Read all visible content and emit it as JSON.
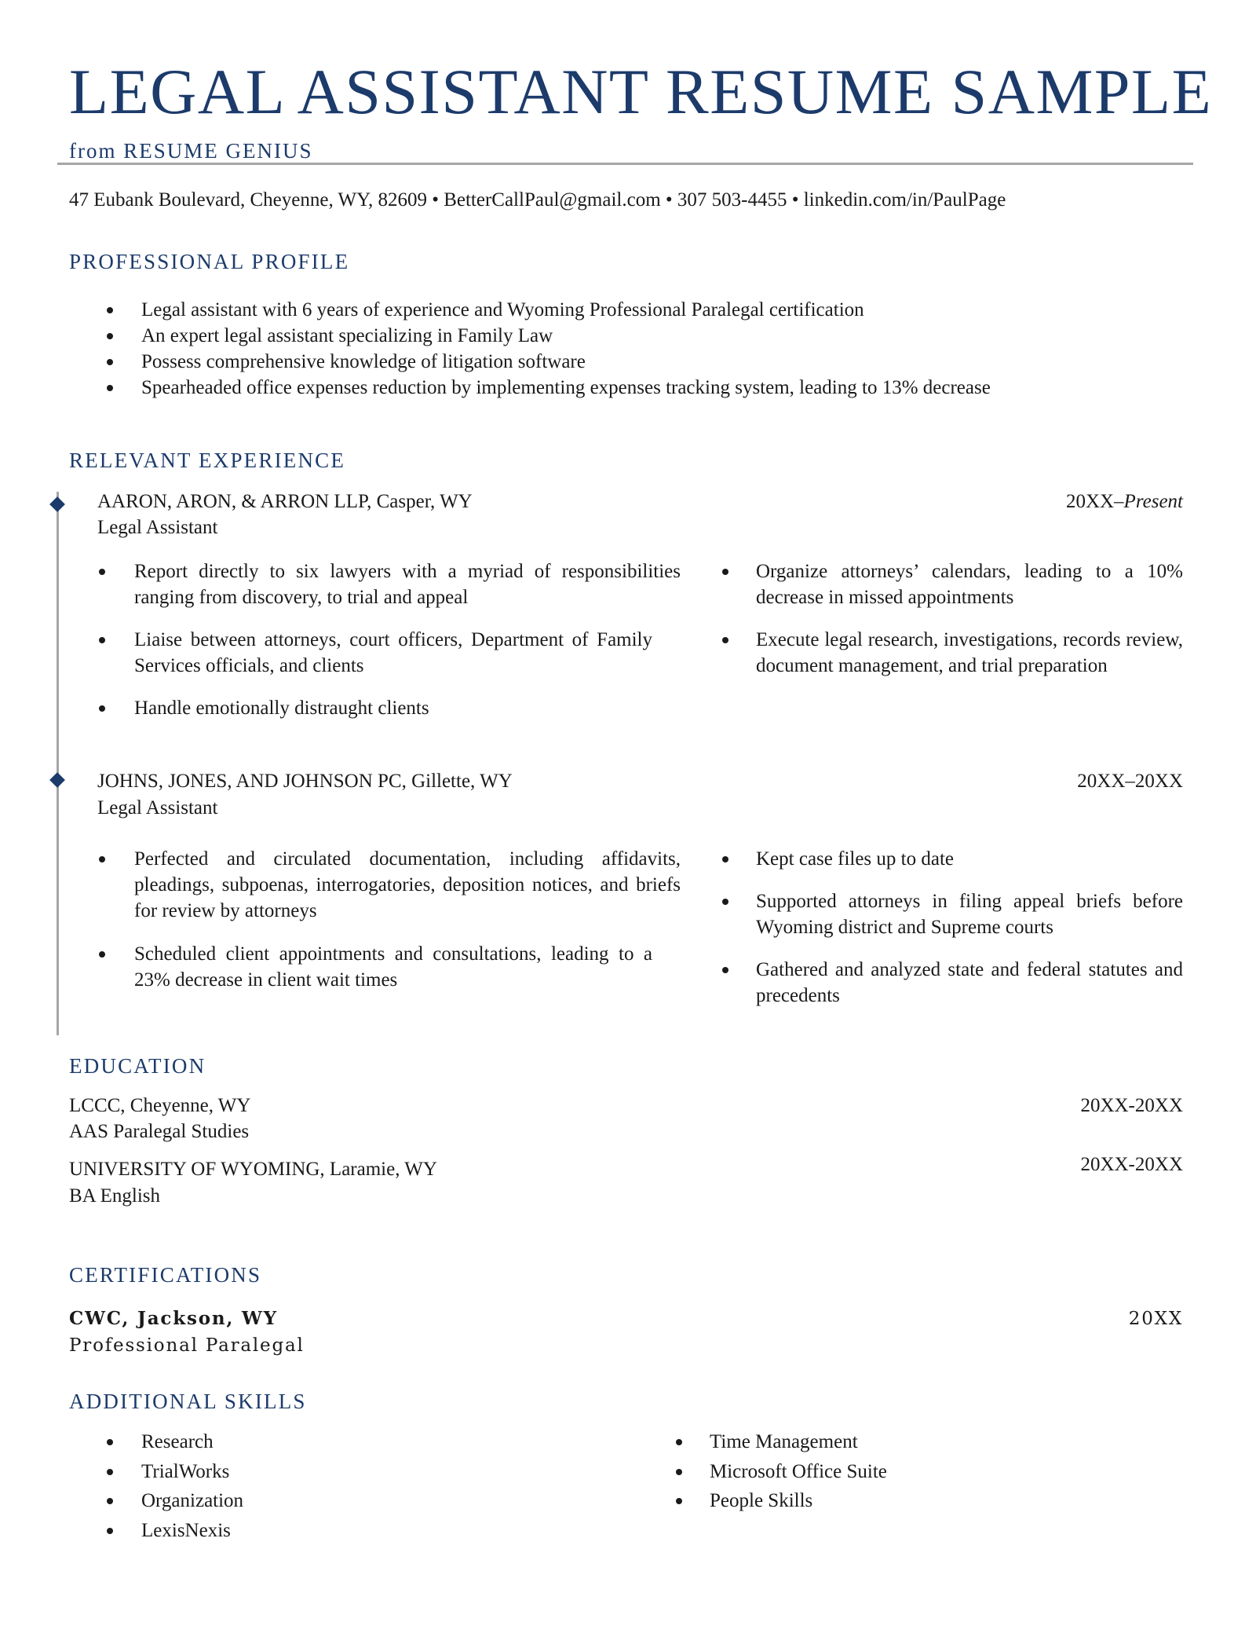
{
  "header": {
    "title": "LEGAL ASSISTANT RESUME SAMPLE",
    "subtitle": "from RESUME GENIUS",
    "contact": "47 Eubank Boulevard, Cheyenne, WY, 82609 • BetterCallPaul@gmail.com • 307 503-4455 • linkedin.com/in/PaulPage"
  },
  "colors": {
    "accent": "#1c3b6b",
    "rule": "#a6a6a6",
    "text": "#1a1a1a"
  },
  "profile": {
    "heading": "PROFESSIONAL PROFILE",
    "bullets": [
      "Legal assistant with 6 years of experience and Wyoming Professional Paralegal certification",
      "An expert legal assistant specializing in Family Law",
      "Possess comprehensive knowledge of litigation software",
      "Spearheaded office expenses reduction by implementing expenses tracking system, leading to 13% decrease"
    ]
  },
  "experience": {
    "heading": "RELEVANT EXPERIENCE",
    "jobs": [
      {
        "employer": "AARON, ARON, & ARRON LLP, Casper, WY",
        "role": "Legal Assistant",
        "date_start": "20XX–",
        "date_end": "Present",
        "left_bullets": [
          "Report directly to six lawyers with a myriad of responsibilities ranging from discovery, to trial and appeal",
          "Liaise between attorneys, court officers, Department of Family Services officials, and clients",
          "Handle emotionally distraught clients"
        ],
        "right_bullets": [
          "Organize attorneys’ calendars, leading to a 10% decrease in missed appointments",
          "Execute legal research, investigations, records review, document management, and trial preparation"
        ]
      },
      {
        "employer": "JOHNS, JONES, AND JOHNSON PC, Gillette, WY",
        "role": "Legal Assistant",
        "date": "20XX–20XX",
        "left_bullets": [
          "Perfected and circulated documentation, including affidavits, pleadings, subpoenas, interrogatories, deposition notices, and briefs for review by attorneys",
          "Scheduled client appointments and consultations, leading to a 23% decrease in client wait times"
        ],
        "right_bullets": [
          "Kept case files up to date",
          "Supported attorneys in filing appeal briefs before Wyoming district and Supreme courts",
          "Gathered and analyzed state and federal statutes and precedents"
        ]
      }
    ]
  },
  "education": {
    "heading": "EDUCATION",
    "entries": [
      {
        "school": "LCCC, Cheyenne, WY",
        "degree": "AAS Paralegal Studies",
        "date": "20XX-20XX"
      },
      {
        "school": "UNIVERSITY OF WYOMING, Laramie, WY",
        "degree": "BA English",
        "date": "20XX-20XX"
      }
    ]
  },
  "certifications": {
    "heading": "CERTIFICATIONS",
    "name": "CWC, Jackson, WY",
    "title": "Professional Paralegal",
    "date": "20XX"
  },
  "skills": {
    "heading": "ADDITIONAL SKILLS",
    "left": [
      "Research",
      "TrialWorks",
      "Organization",
      "LexisNexis"
    ],
    "right": [
      "Time Management",
      "Microsoft Office Suite",
      "People Skills"
    ]
  }
}
